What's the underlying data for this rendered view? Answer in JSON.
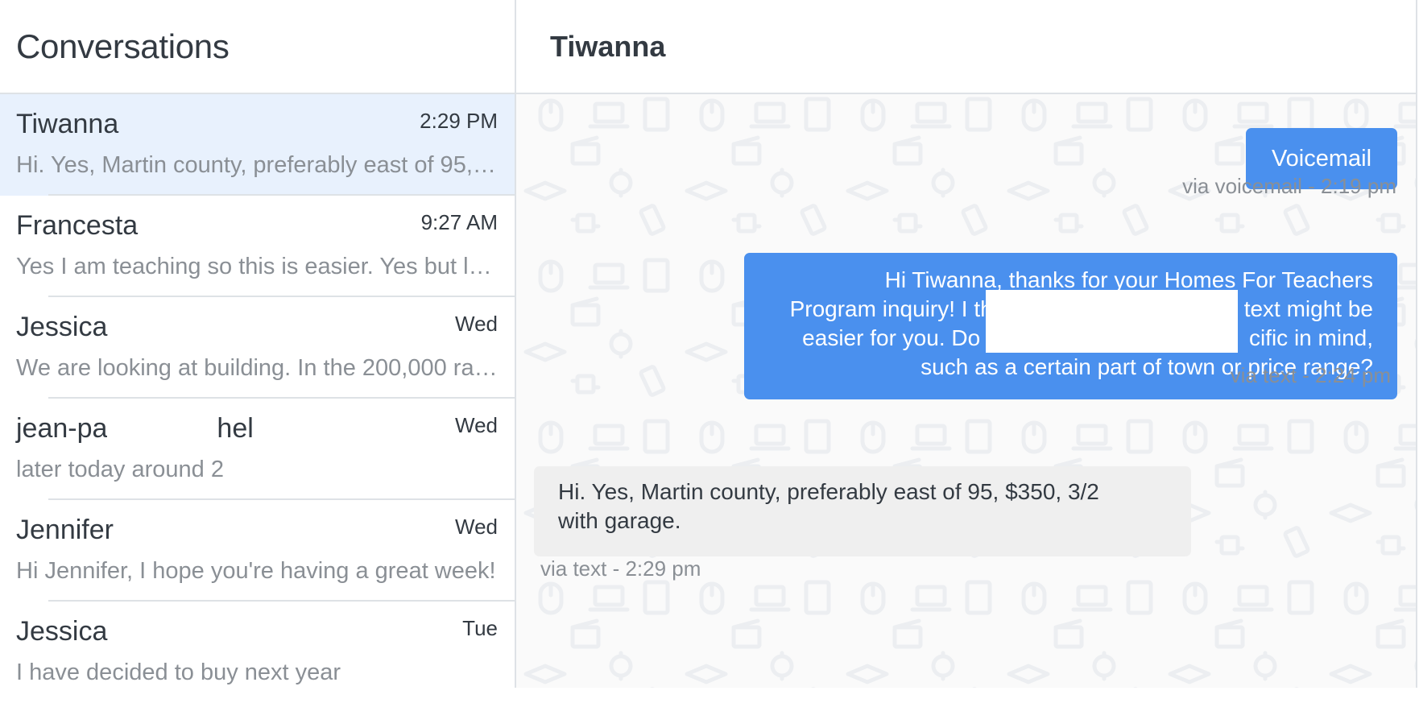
{
  "sidebar": {
    "title": "Conversations",
    "conversations": [
      {
        "name": "Tiwanna",
        "time": "2:29 PM",
        "preview": "Hi. Yes, Martin county, preferably east of 95, $350, 3/2 with garage.",
        "active": true
      },
      {
        "name": "Francesta",
        "time": "9:27 AM",
        "preview": "Yes I am teaching so this is easier. Yes but looking",
        "active": false
      },
      {
        "name": "Jessica",
        "time": "Wed",
        "preview": "We are looking at building. In the 200,000 range",
        "active": false
      },
      {
        "name_start": "jean-pa",
        "name_end": "hel",
        "time": "Wed",
        "preview": "later today around 2",
        "active": false
      },
      {
        "name": "Jennifer",
        "time": "Wed",
        "preview": "Hi Jennifer, I hope you're having a great week!",
        "active": false
      },
      {
        "name": "Jessica",
        "time": "Tue",
        "preview": "I have decided to buy next year",
        "active": false
      }
    ]
  },
  "chat": {
    "title": "Tiwanna",
    "messages": [
      {
        "direction": "outgoing",
        "text": "Voicemail",
        "meta": "via voicemail - 2:19 pm"
      },
      {
        "direction": "outgoing",
        "lines": [
          "Hi Tiwanna, thanks for your Homes For Teachers",
          "Program inquiry! I th",
          "text might be",
          "easier for you. Do y",
          "cific in mind,",
          "such as a certain part of town or price range?"
        ],
        "meta": "via text - 2:24 pm"
      },
      {
        "direction": "incoming",
        "lines": [
          "Hi. Yes, Martin county, preferably east of 95, $350, 3/2",
          "with garage."
        ],
        "meta": "via text - 2:29 pm"
      }
    ]
  },
  "colors": {
    "accent": "#4a90ee",
    "active_row": "#e8f1fd",
    "incoming_bubble": "#efefef",
    "muted_text": "#8a8f95",
    "border": "#dee2e6"
  }
}
